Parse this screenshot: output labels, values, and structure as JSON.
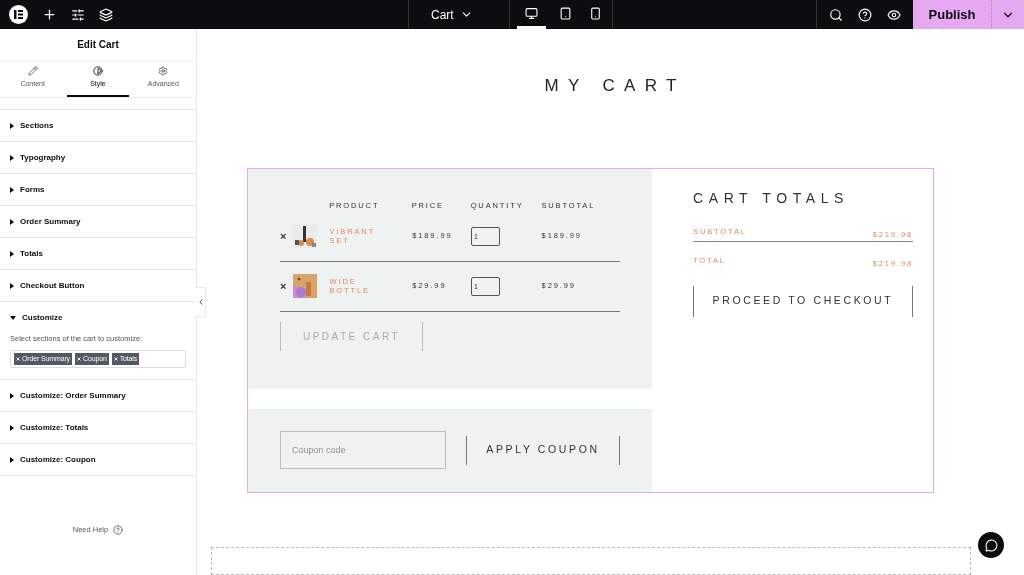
{
  "topbar": {
    "document": "Cart",
    "devices": [
      {
        "kind": "desktop",
        "selected": true
      },
      {
        "kind": "tablet",
        "selected": false
      },
      {
        "kind": "mobile",
        "selected": false
      }
    ],
    "publish": "Publish"
  },
  "sidebar": {
    "title": "Edit Cart",
    "tabs": [
      {
        "label": "Content",
        "kind": "pencil",
        "selected": false
      },
      {
        "label": "Style",
        "kind": "contrast",
        "selected": true
      },
      {
        "label": "Advanced",
        "kind": "gear",
        "selected": false
      }
    ],
    "sections": [
      {
        "label": "Sections",
        "expanded": false
      },
      {
        "label": "Typography",
        "expanded": false
      },
      {
        "label": "Forms",
        "expanded": false
      },
      {
        "label": "Order Summary",
        "expanded": false
      },
      {
        "label": "Totals",
        "expanded": false
      },
      {
        "label": "Checkout Button",
        "expanded": false
      },
      {
        "label": "Customize",
        "expanded": true,
        "field_label": "Select sections of the cart to customize:",
        "tags": [
          "Order Summary",
          "Coupon",
          "Totals"
        ]
      },
      {
        "label": "Customize: Order Summary",
        "expanded": false
      },
      {
        "label": "Customize: Totals",
        "expanded": false
      },
      {
        "label": "Customize: Coupon",
        "expanded": false
      }
    ],
    "help": "Need Help"
  },
  "page": {
    "title": "MY CART",
    "columns": [
      "PRODUCT",
      "PRICE",
      "QUANTITY",
      "SUBTOTAL"
    ],
    "rows": [
      {
        "remove": "×",
        "product": "VIBRANT SET",
        "price": "$189.99",
        "quantity": "1",
        "subtotal": "$189.99"
      },
      {
        "remove": "×",
        "product": "WIDE BOTTLE",
        "price": "$29.99",
        "quantity": "1",
        "subtotal": "$29.99"
      }
    ],
    "update_button": "UPDATE CART",
    "coupon": {
      "placeholder": "Coupon code"
    },
    "apply_button": "APPLY COUPON",
    "totals": {
      "title": "CART TOTALS",
      "rows": [
        {
          "label": "SUBTOTAL",
          "value": "$219.98"
        },
        {
          "label": "TOTAL",
          "value": "$219.98"
        }
      ],
      "checkout": "PROCEED TO CHECKOUT"
    }
  }
}
